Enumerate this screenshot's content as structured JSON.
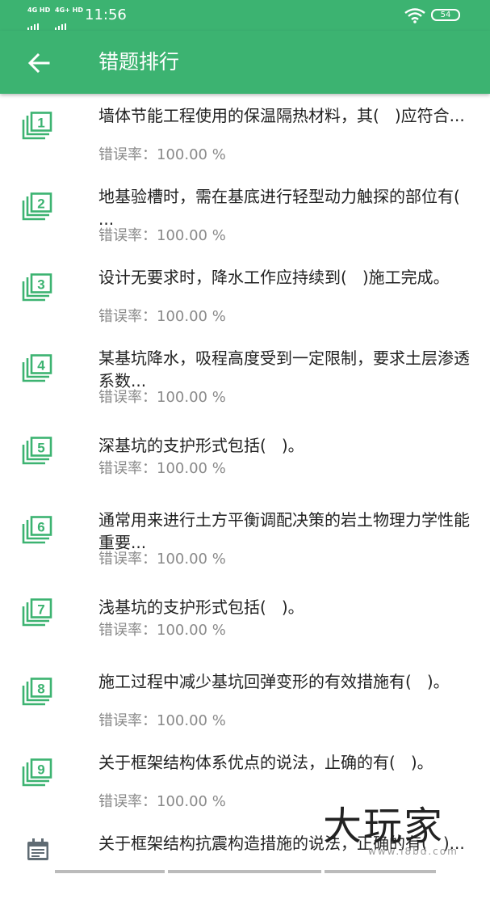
{
  "status_bar": {
    "network1": "4G HD",
    "network2": "4G+ HD",
    "time": "11:56",
    "battery": "54",
    "wifi_icon": "wifi-icon"
  },
  "header": {
    "title": "错题排行",
    "back_icon": "arrow-back-icon",
    "bg_color": "#3cb371"
  },
  "rate_label": "错误率：",
  "items": [
    {
      "num": "1",
      "question": "墙体节能工程使用的保温隔热材料，其(   )应符合...",
      "rate": "100.00 %"
    },
    {
      "num": "2",
      "question": "地基验槽时，需在基底进行轻型动力触探的部位有(   ...",
      "rate": "100.00 %"
    },
    {
      "num": "3",
      "question": "设计无要求时，降水工作应持续到(   )施工完成。",
      "rate": "100.00 %"
    },
    {
      "num": "4",
      "question": "某基坑降水，吸程高度受到一定限制，要求土层渗透系数...",
      "rate": "100.00 %"
    },
    {
      "num": "5",
      "question": "深基坑的支护形式包括(   )。",
      "rate": "100.00 %"
    },
    {
      "num": "6",
      "question": "通常用来进行土方平衡调配决策的岩土物理力学性能重要...",
      "rate": "100.00 %"
    },
    {
      "num": "7",
      "question": "浅基坑的支护形式包括(   )。",
      "rate": "100.00 %"
    },
    {
      "num": "8",
      "question": "施工过程中减少基坑回弹变形的有效措施有(   )。",
      "rate": "100.00 %"
    },
    {
      "num": "9",
      "question": "关于框架结构体系优点的说法，止确的有(   )。",
      "rate": "100.00 %"
    },
    {
      "num": "",
      "question": "关于框架结构抗震构造措施的说法，正确的有(   )...",
      "rate": ""
    }
  ],
  "watermark": {
    "main": "大玩家",
    "sub": "www.i8bd.com"
  }
}
